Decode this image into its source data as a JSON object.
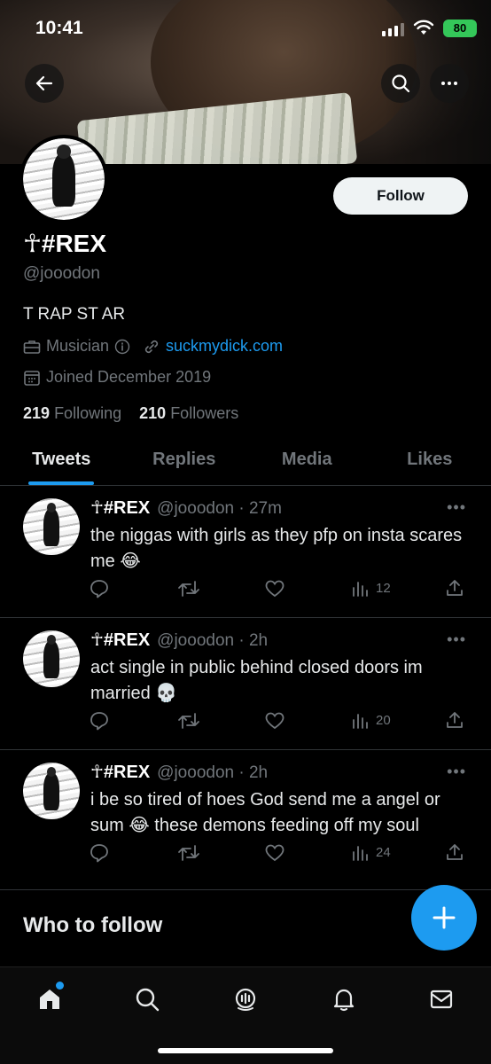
{
  "status": {
    "time": "10:41",
    "battery": "80"
  },
  "profile": {
    "follow_label": "Follow",
    "name": "☥#REX",
    "handle": "@jooodon",
    "bio": "T RAP ST AR",
    "category": "Musician",
    "website": "suckmydick.com",
    "joined": "Joined December 2019",
    "following_count": "219",
    "following_label": "Following",
    "followers_count": "210",
    "followers_label": "Followers"
  },
  "tabs": [
    "Tweets",
    "Replies",
    "Media",
    "Likes"
  ],
  "tweets": [
    {
      "name": "☥#REX",
      "meta": "@jooodon · 27m",
      "text": "the niggas with girls as they pfp on insta scares me 😂",
      "views": "12"
    },
    {
      "name": "☥#REX",
      "meta": "@jooodon · 2h",
      "text": "act single in public behind closed doors im married 💀",
      "views": "20"
    },
    {
      "name": "☥#REX",
      "meta": "@jooodon · 2h",
      "text": "i be so tired of hoes God send me a angel or sum 😂 these demons feeding off my soul",
      "views": "24"
    }
  ],
  "who_to_follow": "Who to follow",
  "colors": {
    "accent": "#1d9bf0",
    "background": "#000000",
    "muted": "#71767b"
  }
}
